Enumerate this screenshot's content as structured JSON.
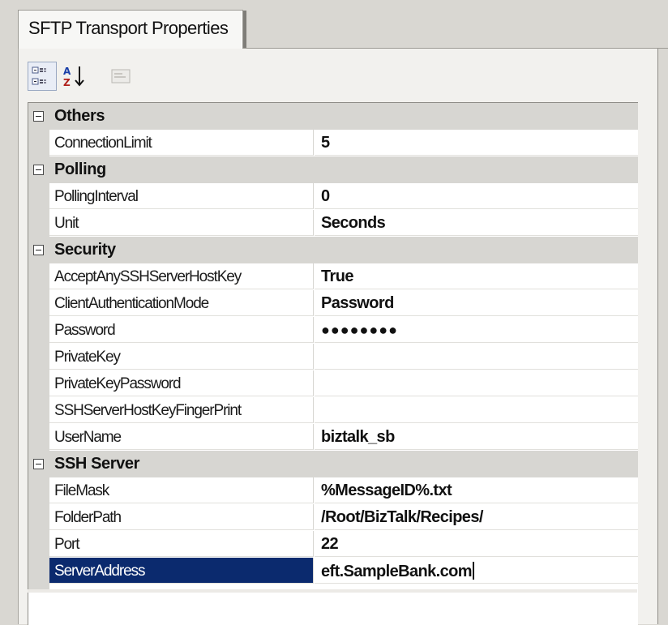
{
  "tab": {
    "label": "SFTP Transport Properties"
  },
  "toolbar": {
    "categorized": {
      "icon": "categorized-icon"
    },
    "alphabetical": {
      "icon": "sort-alphabetical-icon"
    },
    "property_pages": {
      "icon": "property-pages-icon"
    }
  },
  "grid": {
    "categories": [
      {
        "label": "Others",
        "props": [
          {
            "name": "ConnectionLimit",
            "value": "5"
          }
        ]
      },
      {
        "label": "Polling",
        "props": [
          {
            "name": "PollingInterval",
            "value": "0"
          },
          {
            "name": "Unit",
            "value": "Seconds"
          }
        ]
      },
      {
        "label": "Security",
        "props": [
          {
            "name": "AcceptAnySSHServerHostKey",
            "value": "True"
          },
          {
            "name": "ClientAuthenticationMode",
            "value": "Password"
          },
          {
            "name": "Password",
            "value": "●●●●●●●●"
          },
          {
            "name": "PrivateKey",
            "value": ""
          },
          {
            "name": "PrivateKeyPassword",
            "value": ""
          },
          {
            "name": "SSHServerHostKeyFingerPrint",
            "value": ""
          },
          {
            "name": "UserName",
            "value": "biztalk_sb"
          }
        ]
      },
      {
        "label": "SSH Server",
        "props": [
          {
            "name": "FileMask",
            "value": "%MessageID%.txt"
          },
          {
            "name": "FolderPath",
            "value": "/Root/BizTalk/Recipes/"
          },
          {
            "name": "Port",
            "value": "22"
          },
          {
            "name": "ServerAddress",
            "value": "eft.SampleBank.com"
          }
        ]
      }
    ]
  },
  "colors": {
    "selection": "#0b2a6e",
    "category_bg": "#d7d6d2",
    "window_bg": "#f2f1ee"
  }
}
